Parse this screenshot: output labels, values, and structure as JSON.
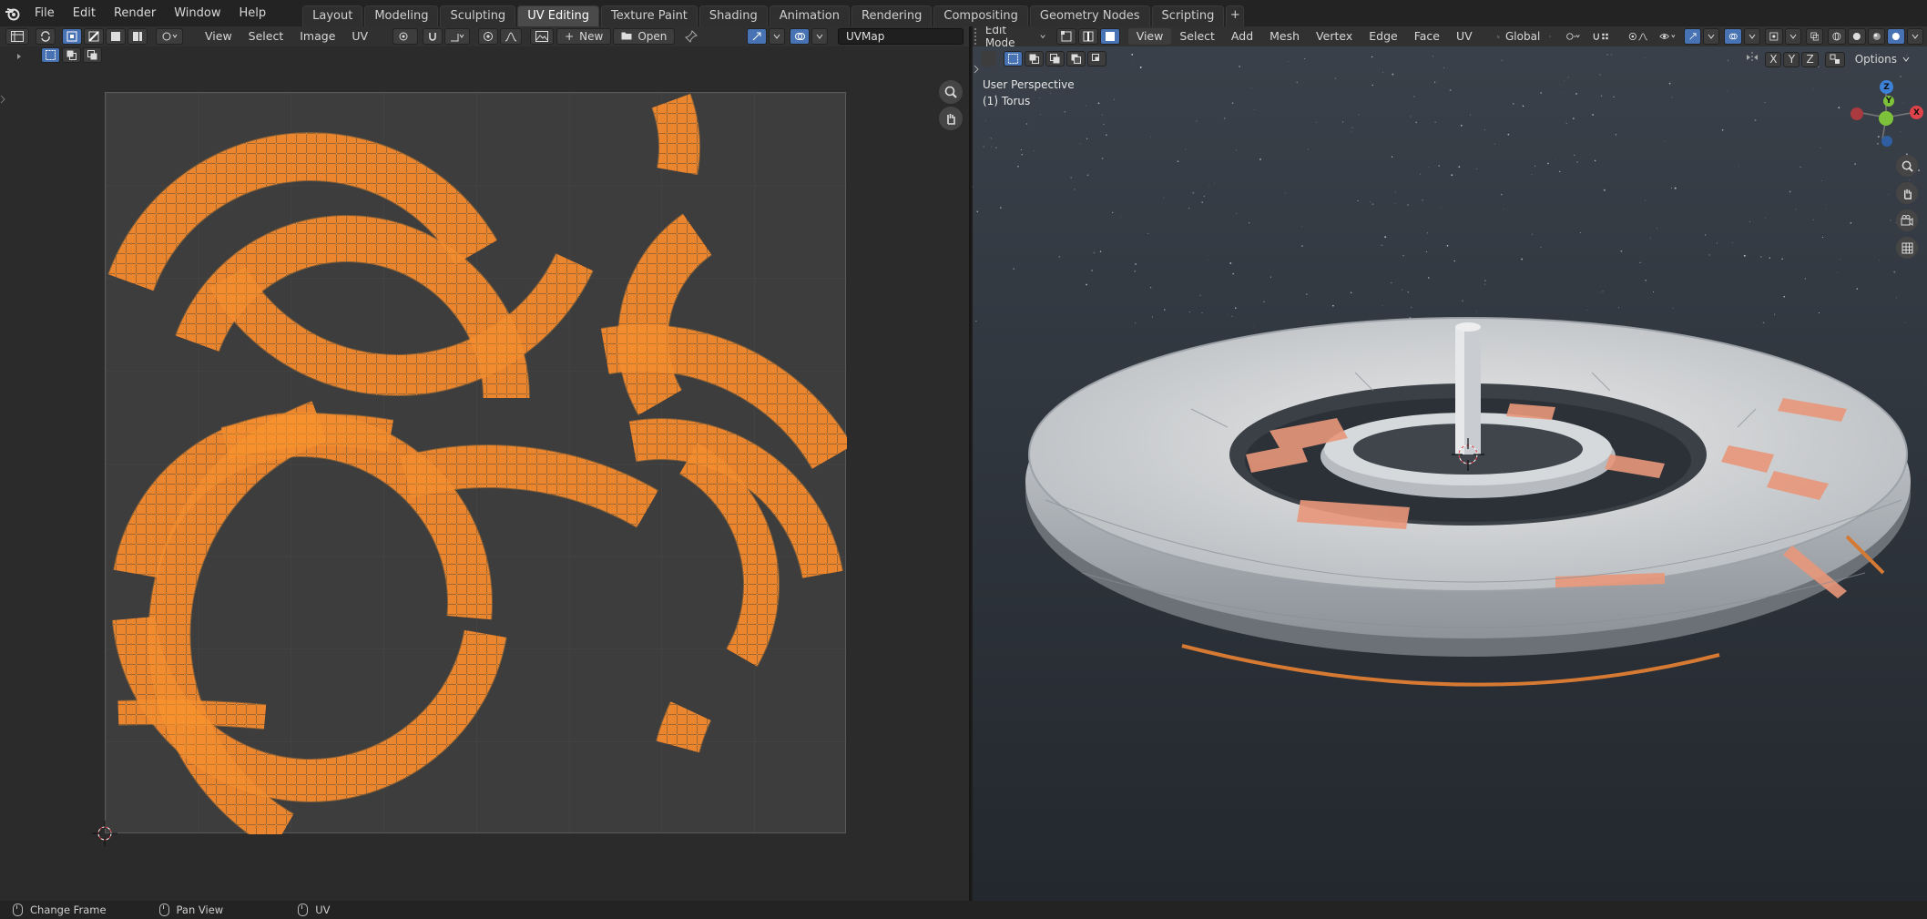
{
  "topbar": {
    "menus": [
      "File",
      "Edit",
      "Render",
      "Window",
      "Help"
    ],
    "workspaces": [
      "Layout",
      "Modeling",
      "Sculpting",
      "UV Editing",
      "Texture Paint",
      "Shading",
      "Animation",
      "Rendering",
      "Compositing",
      "Geometry Nodes",
      "Scripting"
    ],
    "active_workspace": "UV Editing",
    "add_tab_label": "+"
  },
  "uv_editor": {
    "menus": [
      "View",
      "Select",
      "Image",
      "UV"
    ],
    "new_label": "New",
    "open_label": "Open",
    "uvmap_name": "UVMap"
  },
  "viewport": {
    "mode_label": "Edit Mode",
    "menus": [
      "View",
      "Select",
      "Add",
      "Mesh",
      "Vertex",
      "Edge",
      "Face",
      "UV"
    ],
    "orientation_label": "Global",
    "options_label": "Options",
    "axis_labels": [
      "X",
      "Y",
      "Z"
    ],
    "perspective_label": "User Perspective",
    "object_label": "(1) Torus",
    "gizmo": {
      "x": "X",
      "y": "Y",
      "z": "Z"
    }
  },
  "statusbar": {
    "items": [
      "Change Frame",
      "Pan View",
      "UV"
    ]
  },
  "colors": {
    "accent": "#4772b3",
    "uv_face": "#e07a2f",
    "uv_edge": "#ff9a2e",
    "axis_x": "#e0424a",
    "axis_y": "#7dc23a",
    "axis_z": "#3d82d8"
  }
}
